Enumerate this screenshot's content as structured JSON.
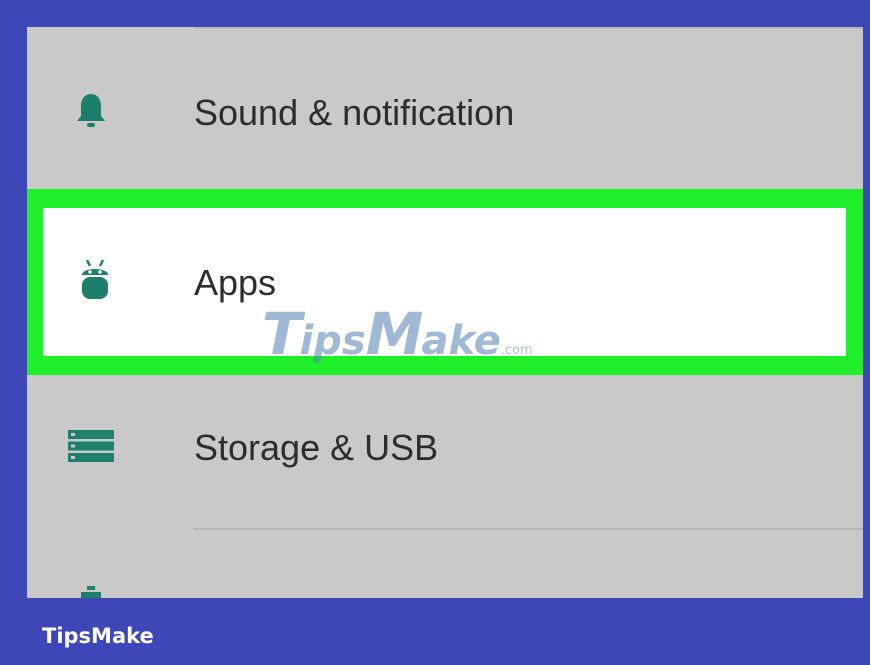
{
  "settings": {
    "items": [
      {
        "label": "Sound & notification",
        "icon": "bell-icon"
      },
      {
        "label": "Apps",
        "icon": "android-icon",
        "highlighted": true
      },
      {
        "label": "Storage & USB",
        "icon": "storage-icon"
      }
    ]
  },
  "watermark": {
    "main_1": "T",
    "main_2": "ips",
    "main_3": "M",
    "main_4": "ake",
    "suffix": ".com"
  },
  "footer": {
    "brand": "TipsMake"
  },
  "colors": {
    "frame": "#3d47b8",
    "highlight": "#21ee2a",
    "icon": "#1d7f6c",
    "background": "#c9c9c9"
  }
}
